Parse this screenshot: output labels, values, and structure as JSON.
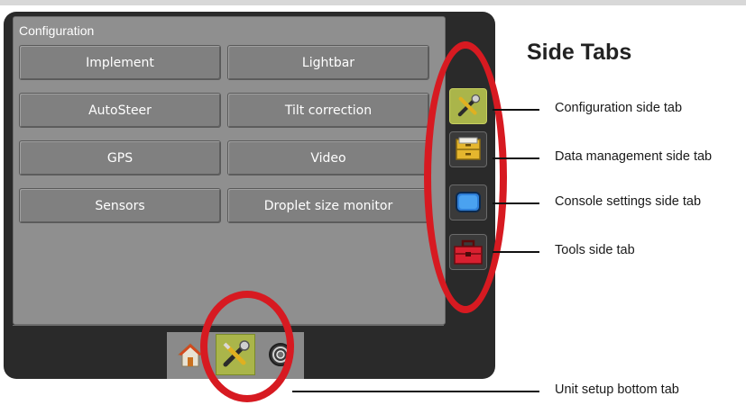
{
  "screen": {
    "title": "Configuration",
    "buttons": [
      {
        "label": "Implement"
      },
      {
        "label": "Lightbar"
      },
      {
        "label": "AutoSteer"
      },
      {
        "label": "Tilt correction"
      },
      {
        "label": "GPS"
      },
      {
        "label": "Video"
      },
      {
        "label": "Sensors"
      },
      {
        "label": "Droplet size monitor"
      }
    ]
  },
  "bottom_tabs": [
    {
      "icon": "home-icon"
    },
    {
      "icon": "wrench-screwdriver-icon",
      "active": true
    },
    {
      "icon": "gauge-icon"
    }
  ],
  "side_tabs": [
    {
      "icon": "wrench-screwdriver-icon",
      "active": true
    },
    {
      "icon": "file-drawer-icon"
    },
    {
      "icon": "monitor-icon"
    },
    {
      "icon": "toolbox-icon"
    }
  ],
  "annotations": {
    "heading": "Side Tabs",
    "callouts": {
      "configuration": "Configuration side tab",
      "data_management": "Data management side tab",
      "console_settings": "Console settings side tab",
      "tools": "Tools side tab",
      "unit_setup": "Unit setup bottom tab"
    }
  },
  "colors": {
    "highlight_circle": "#d71a21",
    "active_tab": "#aab54a",
    "bezel": "#2a2a2a",
    "button_face": "#808080"
  }
}
